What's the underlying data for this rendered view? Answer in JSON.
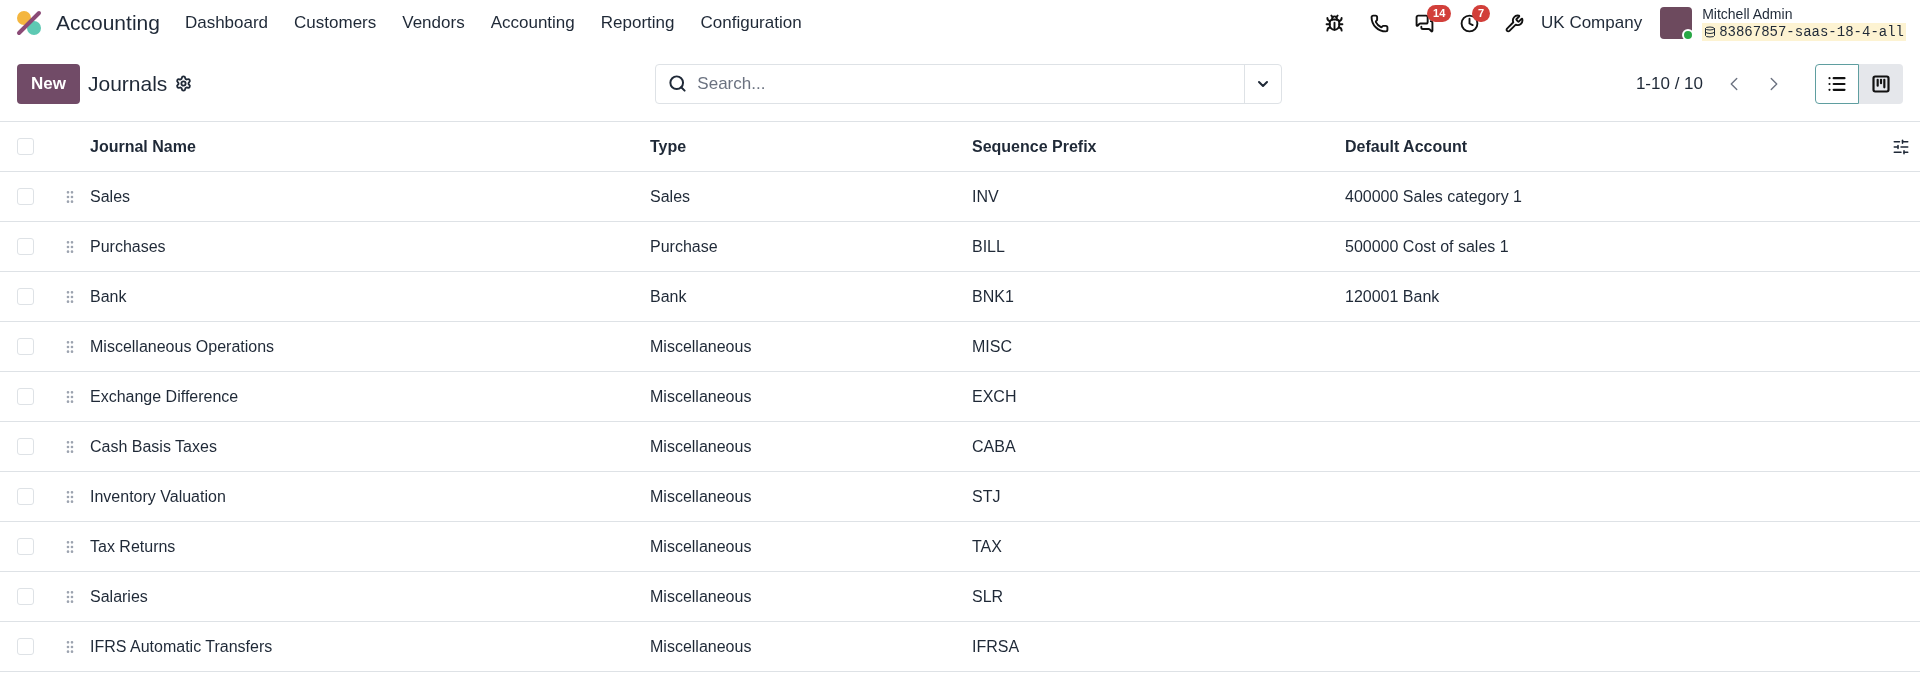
{
  "navbar": {
    "app_name": "Accounting",
    "menu": [
      "Dashboard",
      "Customers",
      "Vendors",
      "Accounting",
      "Reporting",
      "Configuration"
    ],
    "systray": [
      {
        "kind": "bug"
      },
      {
        "kind": "phone"
      },
      {
        "kind": "messages",
        "badge": "14"
      },
      {
        "kind": "activity",
        "badge": "7"
      },
      {
        "kind": "tools"
      }
    ],
    "company": "UK Company",
    "user": {
      "name": "Mitchell Admin",
      "database": "83867857-saas-18-4-all"
    }
  },
  "control_panel": {
    "new_button": "New",
    "title": "Journals",
    "search": {
      "placeholder": "Search..."
    },
    "pager": "1-10 / 10",
    "views": [
      {
        "kind": "list",
        "selected": true
      },
      {
        "kind": "kanban",
        "selected": false
      }
    ]
  },
  "table": {
    "select_all": {
      "checked": false
    },
    "columns": [
      "Journal Name",
      "Type",
      "Sequence Prefix",
      "Default Account"
    ],
    "rows": [
      {
        "checked": false,
        "cells": [
          "Sales",
          "Sales",
          "INV",
          "400000 Sales category 1"
        ]
      },
      {
        "checked": false,
        "cells": [
          "Purchases",
          "Purchase",
          "BILL",
          "500000 Cost of sales 1"
        ]
      },
      {
        "checked": false,
        "cells": [
          "Bank",
          "Bank",
          "BNK1",
          "120001 Bank"
        ]
      },
      {
        "checked": false,
        "cells": [
          "Miscellaneous Operations",
          "Miscellaneous",
          "MISC",
          ""
        ]
      },
      {
        "checked": false,
        "cells": [
          "Exchange Difference",
          "Miscellaneous",
          "EXCH",
          ""
        ]
      },
      {
        "checked": false,
        "cells": [
          "Cash Basis Taxes",
          "Miscellaneous",
          "CABA",
          ""
        ]
      },
      {
        "checked": false,
        "cells": [
          "Inventory Valuation",
          "Miscellaneous",
          "STJ",
          ""
        ]
      },
      {
        "checked": false,
        "cells": [
          "Tax Returns",
          "Miscellaneous",
          "TAX",
          ""
        ]
      },
      {
        "checked": false,
        "cells": [
          "Salaries",
          "Miscellaneous",
          "SLR",
          ""
        ]
      },
      {
        "checked": false,
        "cells": [
          "IFRS Automatic Transfers",
          "Miscellaneous",
          "IFRSA",
          ""
        ]
      }
    ]
  }
}
